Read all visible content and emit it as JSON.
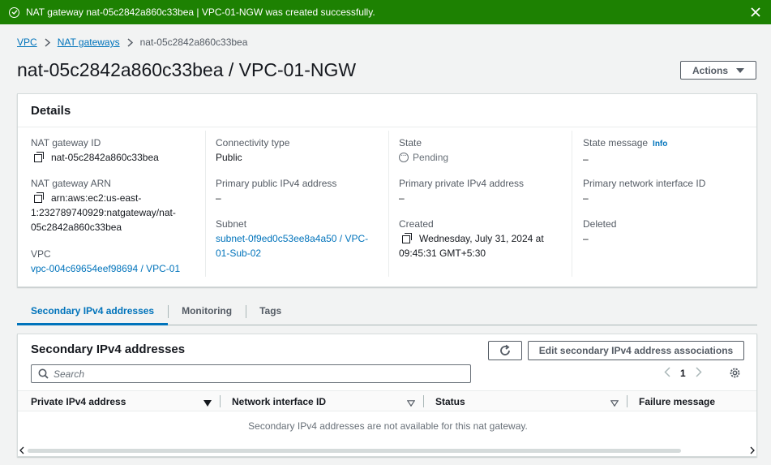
{
  "flash": {
    "message": "NAT gateway nat-05c2842a860c33bea | VPC-01-NGW was created successfully.",
    "color": "#1d8102"
  },
  "breadcrumb": {
    "items": [
      "VPC",
      "NAT gateways"
    ],
    "current": "nat-05c2842a860c33bea"
  },
  "page": {
    "title": "nat-05c2842a860c33bea / VPC-01-NGW",
    "actions_label": "Actions"
  },
  "details": {
    "heading": "Details",
    "nat_gateway_id": {
      "label": "NAT gateway ID",
      "value": "nat-05c2842a860c33bea"
    },
    "nat_gateway_arn": {
      "label": "NAT gateway ARN",
      "value_line1": "arn:aws:ec2:us-east-",
      "value_line2": "1:232789740929:natgateway/nat-",
      "value_line3": "05c2842a860c33bea"
    },
    "vpc": {
      "label": "VPC",
      "value": "vpc-004c69654eef98694 / VPC-01"
    },
    "connectivity_type": {
      "label": "Connectivity type",
      "value": "Public"
    },
    "primary_public_ipv4": {
      "label": "Primary public IPv4 address",
      "value": "–"
    },
    "subnet": {
      "label": "Subnet",
      "value_line1": "subnet-0f9ed0c53ee8a4a50 / VPC-",
      "value_line2": "01-Sub-02"
    },
    "state": {
      "label": "State",
      "value": "Pending"
    },
    "primary_private_ipv4": {
      "label": "Primary private IPv4 address",
      "value": "–"
    },
    "created": {
      "label": "Created",
      "value_line1": "Wednesday, July 31, 2024 at",
      "value_line2": "09:45:31 GMT+5:30"
    },
    "state_message": {
      "label": "State message",
      "info": "Info",
      "value": "–"
    },
    "primary_eni": {
      "label": "Primary network interface ID",
      "value": "–"
    },
    "deleted": {
      "label": "Deleted",
      "value": "–"
    }
  },
  "tabs": [
    "Secondary IPv4 addresses",
    "Monitoring",
    "Tags"
  ],
  "secondary": {
    "heading": "Secondary IPv4 addresses",
    "edit_label": "Edit secondary IPv4 address associations",
    "search_placeholder": "Search",
    "page": "1",
    "columns": [
      "Private IPv4 address",
      "Network interface ID",
      "Status",
      "Failure message"
    ],
    "empty_text": "Secondary IPv4 addresses are not available for this nat gateway."
  },
  "colors": {
    "link": "#0073bb",
    "success": "#1d8102"
  }
}
